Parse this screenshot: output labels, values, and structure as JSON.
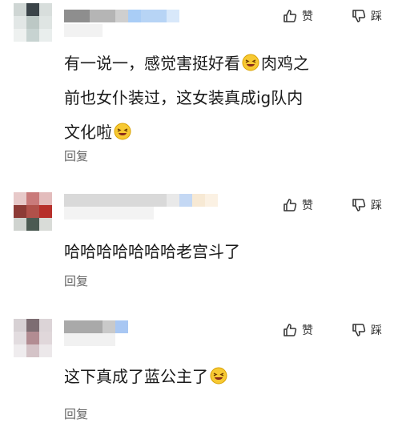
{
  "actions": {
    "like_label": "赞",
    "dislike_label": "踩"
  },
  "comments": [
    {
      "lines": [
        "有一说一，感觉害挺好看",
        "肉鸡之",
        "前也女仆装过，这女装真成ig队内",
        "文化啦",
        ""
      ],
      "reply_label": "回复",
      "emoji_icon": "laughing-emoji-icon"
    },
    {
      "lines": [
        "哈哈哈哈哈哈哈老宫斗了"
      ],
      "reply_label": "回复"
    },
    {
      "lines": [
        "这下真成了蓝公主了"
      ],
      "reply_label": "回复",
      "emoji_icon": "laughing-emoji-icon"
    }
  ],
  "colors": {
    "text": "#1a1a1a",
    "secondary": "#666666",
    "accent_blur": "#b9d3f5"
  }
}
